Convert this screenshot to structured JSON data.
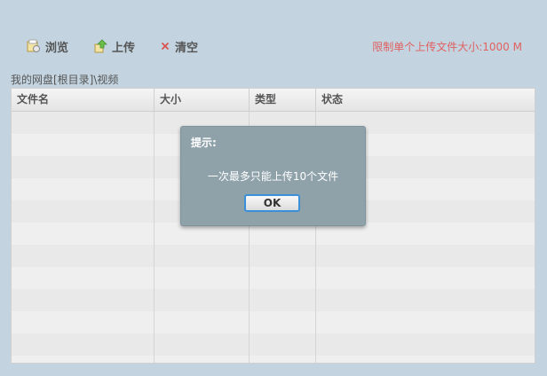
{
  "toolbar": {
    "browse_label": "浏览",
    "upload_label": "上传",
    "clear_label": "清空",
    "limit_text": "限制单个上传文件大小:1000 M"
  },
  "breadcrumb": "我的网盘[根目录]\\视频",
  "table": {
    "columns": [
      "文件名",
      "大小",
      "类型",
      "状态"
    ],
    "rows": []
  },
  "dialog": {
    "title": "提示:",
    "message": "一次最多只能上传10个文件",
    "ok_label": "OK"
  },
  "colors": {
    "background": "#c3d4e0",
    "limit_text": "#e06060",
    "dialog_bg": "#8fa2aa",
    "ok_border": "#3a8fd9"
  }
}
